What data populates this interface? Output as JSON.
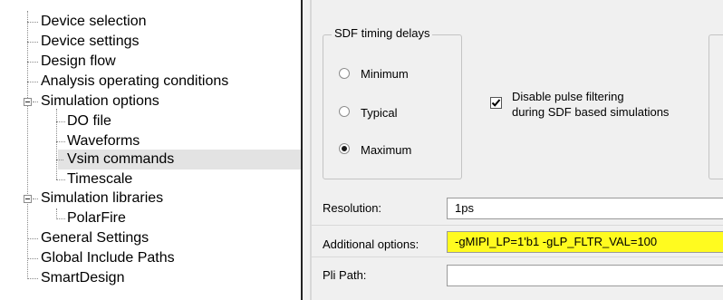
{
  "tree": {
    "items": [
      {
        "label": "Device selection"
      },
      {
        "label": "Device settings"
      },
      {
        "label": "Design flow"
      },
      {
        "label": "Analysis operating conditions"
      },
      {
        "label": "Simulation options"
      },
      {
        "label": "DO file"
      },
      {
        "label": "Waveforms"
      },
      {
        "label": "Vsim commands"
      },
      {
        "label": "Timescale"
      },
      {
        "label": "Simulation libraries"
      },
      {
        "label": "PolarFire"
      },
      {
        "label": "General Settings"
      },
      {
        "label": "Global Include Paths"
      },
      {
        "label": "SmartDesign"
      }
    ],
    "selected": "Vsim commands"
  },
  "sdf_group": {
    "title": "SDF timing delays",
    "options": [
      "Minimum",
      "Typical",
      "Maximum"
    ],
    "selected": "Maximum"
  },
  "pulse_filter": {
    "label_line1": "Disable pulse filtering",
    "label_line2": "during SDF based simulations",
    "checked": true
  },
  "fields": {
    "resolution": {
      "label": "Resolution:",
      "value": "1ps"
    },
    "additional_options": {
      "label": "Additional options:",
      "value": "-gMIPI_LP=1'b1 -gLP_FLTR_VAL=100",
      "highlight_color": "#fffb1f"
    },
    "pli_path": {
      "label": "Pli Path:",
      "value": ""
    }
  }
}
